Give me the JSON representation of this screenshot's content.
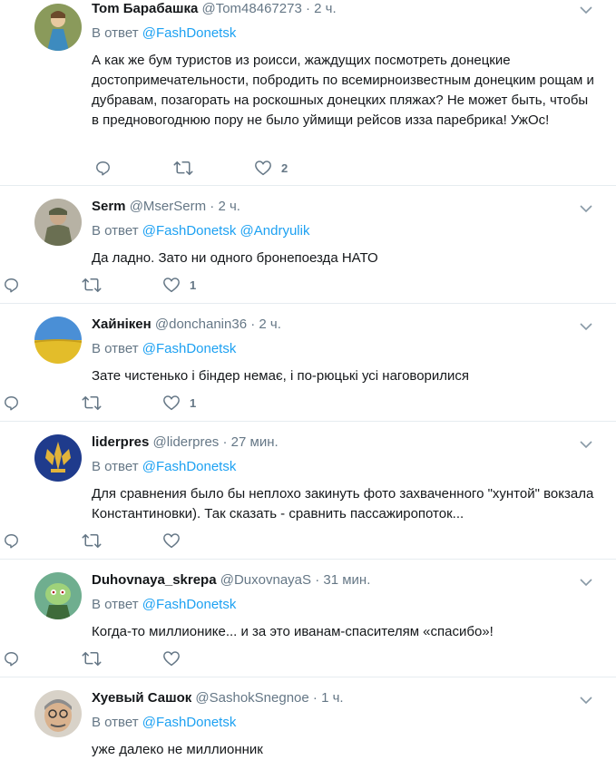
{
  "tweets": [
    {
      "name": "Tom Барабашка",
      "handle": "@Tom48467273",
      "time": "2 ч.",
      "reply_prefix": "В ответ",
      "mentions": [
        "@FashDonetsk"
      ],
      "text": "А как же бум туристов из роисси, жаждущих посмотреть донецкие достопримечательности, побродить по всемирноизвестным донецким рощам и дубравам, позагорать на роскошных донецких пляжах? Не может быть, чтобы в предновогоднюю пору не было уймищи рейсов изза паребрика! УжОс!",
      "likes": "2"
    },
    {
      "name": "Serm",
      "handle": "@MserSerm",
      "time": "2 ч.",
      "reply_prefix": "В ответ",
      "mentions": [
        "@FashDonetsk",
        "@Andryulik"
      ],
      "text": "Да ладно. Зато ни одного бронепоезда НАТО",
      "likes": "1"
    },
    {
      "name": "Хайнікен",
      "handle": "@donchanin36",
      "time": "2 ч.",
      "reply_prefix": "В ответ",
      "mentions": [
        "@FashDonetsk"
      ],
      "text": "Зате чистенько і біндер немає, і по-рюцькі усі наговорилися",
      "likes": "1"
    },
    {
      "name": "liderpres",
      "handle": "@liderpres",
      "time": "27 мин.",
      "reply_prefix": "В ответ",
      "mentions": [
        "@FashDonetsk"
      ],
      "text": "Для сравнения было бы неплохо закинуть фото захваченного \"хунтой\" вокзала Константиновки). Так сказать - сравнить пассажиропоток...",
      "likes": ""
    },
    {
      "name": "Duhovnaya_skrepa",
      "handle": "@DuxovnayaS",
      "time": "31 мин.",
      "reply_prefix": "В ответ",
      "mentions": [
        "@FashDonetsk"
      ],
      "text": "Когда-то миллионике... и за это иванам-спасителям «спасибо»!",
      "likes": ""
    },
    {
      "name": "Хуевый Сашок",
      "handle": "@SashokSnegnoe",
      "time": "1 ч.",
      "reply_prefix": "В ответ",
      "mentions": [
        "@FashDonetsk"
      ],
      "text": "уже далеко не миллионник",
      "likes": ""
    }
  ],
  "icons": {
    "reply": "reply-icon",
    "retweet": "retweet-icon",
    "like": "heart-icon",
    "menu": "chevron-down-icon"
  },
  "colors": {
    "name": "#14171a",
    "secondary": "#657786",
    "link": "#1da1f2",
    "divider": "#e6ecf0"
  }
}
